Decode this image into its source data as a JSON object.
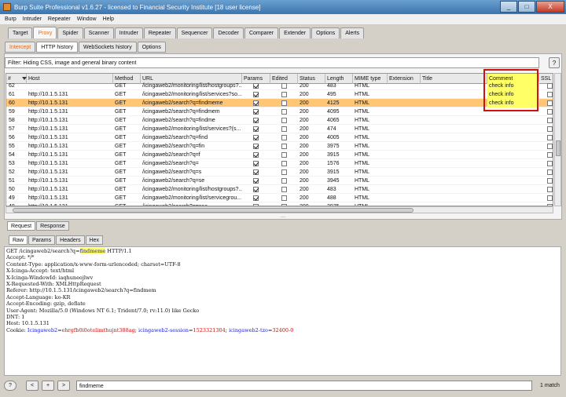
{
  "window": {
    "title": "Burp Suite Professional v1.6.27 - licensed to Financial Security Institute [18 user license]",
    "min": "_",
    "max": "□",
    "close": "X"
  },
  "menu": [
    "Burp",
    "Intruder",
    "Repeater",
    "Window",
    "Help"
  ],
  "main_tabs": [
    "Target",
    "Proxy",
    "Spider",
    "Scanner",
    "Intruder",
    "Repeater",
    "Sequencer",
    "Decoder",
    "Comparer",
    "Extender",
    "Options",
    "Alerts"
  ],
  "active_main_tab": "Proxy",
  "proxy_tabs": [
    "Intercept",
    "HTTP history",
    "WebSockets history",
    "Options"
  ],
  "filter": "Filter: Hiding CSS, image and general binary content",
  "help": "?",
  "columns": [
    "#",
    "Host",
    "Method",
    "URL",
    "Params",
    "Edited",
    "Status",
    "Length",
    "MIME type",
    "Extension",
    "Title",
    "Comment",
    "SSL"
  ],
  "rows": [
    {
      "num": "62",
      "host": "",
      "method": "GET",
      "url": "/icingaweb2/monitoring/list/hostgroups?...",
      "params": true,
      "edited": false,
      "status": "200",
      "length": "483",
      "mime": "HTML",
      "comment": "check info",
      "partial": true
    },
    {
      "num": "61",
      "host": "http://10.1.5.131",
      "method": "GET",
      "url": "/icingaweb2/monitoring/list/services?so...",
      "params": true,
      "edited": false,
      "status": "200",
      "length": "495",
      "mime": "HTML",
      "comment": "check info"
    },
    {
      "num": "60",
      "host": "http://10.1.5.131",
      "method": "GET",
      "url": "/icingaweb2/search?q=findmeme",
      "params": true,
      "edited": false,
      "status": "200",
      "length": "4125",
      "mime": "HTML",
      "comment": "check info",
      "selected": true
    },
    {
      "num": "59",
      "host": "http://10.1.5.131",
      "method": "GET",
      "url": "/icingaweb2/search?q=findmem",
      "params": true,
      "edited": false,
      "status": "200",
      "length": "4095",
      "mime": "HTML",
      "comment": ""
    },
    {
      "num": "58",
      "host": "http://10.1.5.131",
      "method": "GET",
      "url": "/icingaweb2/search?q=findme",
      "params": true,
      "edited": false,
      "status": "200",
      "length": "4065",
      "mime": "HTML",
      "comment": ""
    },
    {
      "num": "57",
      "host": "http://10.1.5.131",
      "method": "GET",
      "url": "/icingaweb2/monitoring/list/services?(s...",
      "params": true,
      "edited": false,
      "status": "200",
      "length": "474",
      "mime": "HTML",
      "comment": ""
    },
    {
      "num": "56",
      "host": "http://10.1.5.131",
      "method": "GET",
      "url": "/icingaweb2/search?q=find",
      "params": true,
      "edited": false,
      "status": "200",
      "length": "4005",
      "mime": "HTML",
      "comment": ""
    },
    {
      "num": "55",
      "host": "http://10.1.5.131",
      "method": "GET",
      "url": "/icingaweb2/search?q=fin",
      "params": true,
      "edited": false,
      "status": "200",
      "length": "3975",
      "mime": "HTML",
      "comment": ""
    },
    {
      "num": "54",
      "host": "http://10.1.5.131",
      "method": "GET",
      "url": "/icingaweb2/search?q=f",
      "params": true,
      "edited": false,
      "status": "200",
      "length": "3915",
      "mime": "HTML",
      "comment": ""
    },
    {
      "num": "53",
      "host": "http://10.1.5.131",
      "method": "GET",
      "url": "/icingaweb2/search?q=",
      "params": true,
      "edited": false,
      "status": "200",
      "length": "1576",
      "mime": "HTML",
      "comment": ""
    },
    {
      "num": "52",
      "host": "http://10.1.5.131",
      "method": "GET",
      "url": "/icingaweb2/search?q=s",
      "params": true,
      "edited": false,
      "status": "200",
      "length": "3915",
      "mime": "HTML",
      "comment": ""
    },
    {
      "num": "51",
      "host": "http://10.1.5.131",
      "method": "GET",
      "url": "/icingaweb2/search?q=se",
      "params": true,
      "edited": false,
      "status": "200",
      "length": "3945",
      "mime": "HTML",
      "comment": ""
    },
    {
      "num": "50",
      "host": "http://10.1.5.131",
      "method": "GET",
      "url": "/icingaweb2/monitoring/list/hostgroups?...",
      "params": true,
      "edited": false,
      "status": "200",
      "length": "483",
      "mime": "HTML",
      "comment": ""
    },
    {
      "num": "49",
      "host": "http://10.1.5.131",
      "method": "GET",
      "url": "/icingaweb2/monitoring/list/servicegrou...",
      "params": true,
      "edited": false,
      "status": "200",
      "length": "488",
      "mime": "HTML",
      "comment": ""
    },
    {
      "num": "48",
      "host": "http://10.1.5.131",
      "method": "GET",
      "url": "/icingaweb2/search?q=sea",
      "params": true,
      "edited": false,
      "status": "200",
      "length": "3975",
      "mime": "HTML",
      "comment": "",
      "partial": true
    }
  ],
  "splitter": "....",
  "message_tabs": [
    "Request",
    "Response"
  ],
  "view_tabs": [
    "Raw",
    "Params",
    "Headers",
    "Hex"
  ],
  "request": {
    "line_method": "GET /icingaweb2/search?q=",
    "line_param": "findmeme",
    "line_version": " HTTP/1.1",
    "headers": [
      "Accept: */*",
      "Content-Type: application/x-www-form-urlencoded; charset=UTF-8",
      "X-Icinga-Accept: text/html",
      "X-Icinga-WindowId: iaqhuneojlwv",
      "X-Requested-With: XMLHttpRequest",
      "Referer: http://10.1.5.131/icingaweb2/search?q=findmem",
      "Accept-Language: ko-KR",
      "Accept-Encoding: gzip, deflate",
      "User-Agent: Mozilla/5.0 (Windows NT 6.1; Trident/7.0; rv:11.0) like Gecko",
      "DNT: 1",
      "Host: 10.1.5.131"
    ],
    "cookie_label": "Cookie: ",
    "cookie_1_name": "Icingaweb2",
    "cookie_1_value": "ehrgfb0i0otelimthujnt388ag",
    "cookie_2_name": "icingaweb2-session",
    "cookie_2_value": "1523321304",
    "cookie_3_name": "icingaweb2-tzo",
    "cookie_3_value": "32400-0"
  },
  "search": {
    "help": "?",
    "prev": "<",
    "next": "+",
    "fwd": ">",
    "value": "findmeme",
    "matches": "1 match"
  },
  "colors": {
    "accent_orange": "#e56f1b",
    "selected_row": "#ffc675",
    "comment_highlight": "#ffff66",
    "annotation_red": "#d01010"
  }
}
